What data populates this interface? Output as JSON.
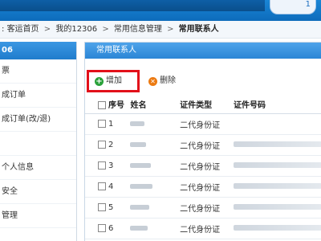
{
  "breadcrumb": {
    "items": [
      "客运首页",
      "我的12306",
      "常用信息管理"
    ],
    "current": "常用联系人",
    "separator": ">"
  },
  "topbar": {
    "pill_text": "1"
  },
  "sidebar": {
    "header": "06",
    "items": [
      {
        "label": "票"
      },
      {
        "label": "成订单"
      },
      {
        "label": "成订单(改/退)"
      },
      {
        "label": ""
      },
      {
        "label": "个人信息"
      },
      {
        "label": "安全"
      },
      {
        "label": "管理"
      }
    ]
  },
  "panel": {
    "title": "常用联系人",
    "toolbar": {
      "add_label": "增加",
      "delete_label": "删除"
    }
  },
  "table": {
    "headers": {
      "seq": "序号",
      "name": "姓名",
      "id_type": "证件类型",
      "id_number": "证件号码"
    },
    "rows": [
      {
        "seq": "1",
        "id_type": "二代身份证"
      },
      {
        "seq": "2",
        "id_type": "二代身份证"
      },
      {
        "seq": "3",
        "id_type": "二代身份证"
      },
      {
        "seq": "4",
        "id_type": "二代身份证"
      },
      {
        "seq": "5",
        "id_type": "二代身份证"
      },
      {
        "seq": "6",
        "id_type": "二代身份证"
      }
    ]
  },
  "colors": {
    "accent": "#2b86d6",
    "highlight": "#e2101a",
    "add": "#2aa13a",
    "delete": "#ec7a12"
  }
}
